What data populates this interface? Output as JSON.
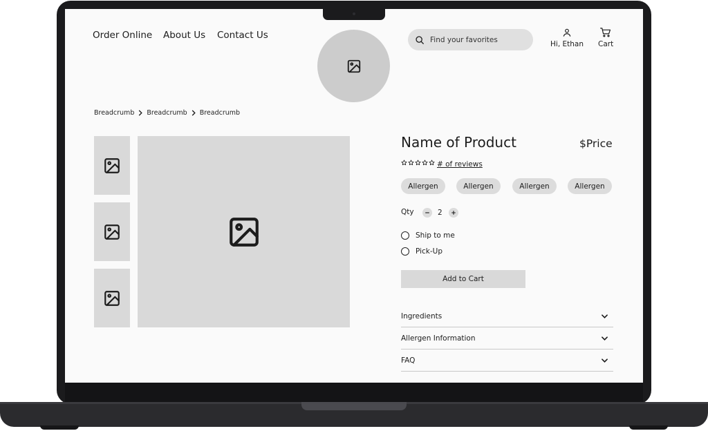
{
  "nav": {
    "items": [
      "Order Online",
      "About Us",
      "Contact Us"
    ]
  },
  "search": {
    "placeholder": "Find your favorites"
  },
  "account": {
    "label": "Hi, Ethan"
  },
  "cart": {
    "label": "Cart"
  },
  "breadcrumbs": [
    "Breadcrumb",
    "Breadcrumb",
    "Breadcrumb"
  ],
  "product": {
    "name": "Name of Product",
    "price": "$Price",
    "reviews_link": "# of reviews",
    "rating_stars": 5,
    "allergens": [
      "Allergen",
      "Allergen",
      "Allergen",
      "Allergen"
    ],
    "qty_label": "Qty",
    "qty_value": "2",
    "fulfillment": [
      "Ship to me",
      "Pick-Up"
    ],
    "add_to_cart": "Add to Cart"
  },
  "accordions": [
    "Ingredients",
    "Allergen Information",
    "FAQ"
  ],
  "icons": {
    "image": "image-icon",
    "search": "search-icon",
    "user": "user-icon",
    "cart": "cart-icon",
    "chevron": "chevron-down-icon",
    "star": "star-outline-icon"
  }
}
